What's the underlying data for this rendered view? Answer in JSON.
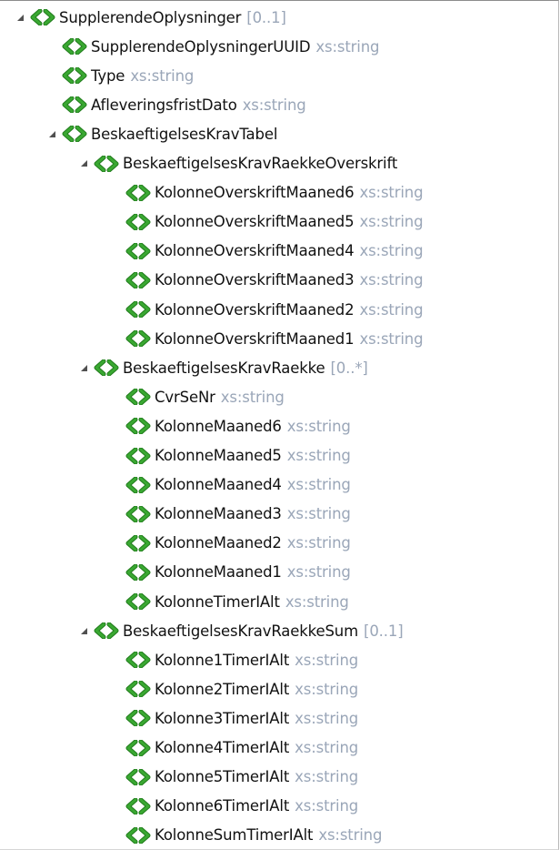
{
  "palette": {
    "icon_green": "#3aa832",
    "icon_green_dark": "#1f7a1a",
    "name_text": "#111111",
    "type_text": "#9aa6b8",
    "toggle": "#505050"
  },
  "tree": {
    "rows": [
      {
        "name": "SupplerendeOplysninger",
        "type": "[0..1]",
        "depth": 0,
        "expandable": true,
        "icon": "element-icon"
      },
      {
        "name": "SupplerendeOplysningerUUID",
        "type": "xs:string",
        "depth": 1,
        "expandable": false,
        "icon": "element-icon"
      },
      {
        "name": "Type",
        "type": "xs:string",
        "depth": 1,
        "expandable": false,
        "icon": "element-icon"
      },
      {
        "name": "AfleveringsfristDato",
        "type": "xs:string",
        "depth": 1,
        "expandable": false,
        "icon": "element-icon"
      },
      {
        "name": "BeskaeftigelsesKravTabel",
        "type": "",
        "depth": 1,
        "expandable": true,
        "icon": "element-icon"
      },
      {
        "name": "BeskaeftigelsesKravRaekkeOverskrift",
        "type": "",
        "depth": 2,
        "expandable": true,
        "icon": "element-icon"
      },
      {
        "name": "KolonneOverskriftMaaned6",
        "type": "xs:string",
        "depth": 3,
        "expandable": false,
        "icon": "element-icon"
      },
      {
        "name": "KolonneOverskriftMaaned5",
        "type": "xs:string",
        "depth": 3,
        "expandable": false,
        "icon": "element-icon"
      },
      {
        "name": "KolonneOverskriftMaaned4",
        "type": "xs:string",
        "depth": 3,
        "expandable": false,
        "icon": "element-icon"
      },
      {
        "name": "KolonneOverskriftMaaned3",
        "type": "xs:string",
        "depth": 3,
        "expandable": false,
        "icon": "element-icon"
      },
      {
        "name": "KolonneOverskriftMaaned2",
        "type": "xs:string",
        "depth": 3,
        "expandable": false,
        "icon": "element-icon"
      },
      {
        "name": "KolonneOverskriftMaaned1",
        "type": "xs:string",
        "depth": 3,
        "expandable": false,
        "icon": "element-icon"
      },
      {
        "name": "BeskaeftigelsesKravRaekke",
        "type": "[0..*]",
        "depth": 2,
        "expandable": true,
        "icon": "element-icon"
      },
      {
        "name": "CvrSeNr",
        "type": "xs:string",
        "depth": 3,
        "expandable": false,
        "icon": "element-icon"
      },
      {
        "name": "KolonneMaaned6",
        "type": "xs:string",
        "depth": 3,
        "expandable": false,
        "icon": "element-icon"
      },
      {
        "name": "KolonneMaaned5",
        "type": "xs:string",
        "depth": 3,
        "expandable": false,
        "icon": "element-icon"
      },
      {
        "name": "KolonneMaaned4",
        "type": "xs:string",
        "depth": 3,
        "expandable": false,
        "icon": "element-icon"
      },
      {
        "name": "KolonneMaaned3",
        "type": "xs:string",
        "depth": 3,
        "expandable": false,
        "icon": "element-icon"
      },
      {
        "name": "KolonneMaaned2",
        "type": "xs:string",
        "depth": 3,
        "expandable": false,
        "icon": "element-icon"
      },
      {
        "name": "KolonneMaaned1",
        "type": "xs:string",
        "depth": 3,
        "expandable": false,
        "icon": "element-icon"
      },
      {
        "name": "KolonneTimerIAlt",
        "type": "xs:string",
        "depth": 3,
        "expandable": false,
        "icon": "element-icon"
      },
      {
        "name": "BeskaeftigelsesKravRaekkeSum",
        "type": "[0..1]",
        "depth": 2,
        "expandable": true,
        "icon": "element-icon"
      },
      {
        "name": "Kolonne1TimerIAlt",
        "type": "xs:string",
        "depth": 3,
        "expandable": false,
        "icon": "element-icon"
      },
      {
        "name": "Kolonne2TimerIAlt",
        "type": "xs:string",
        "depth": 3,
        "expandable": false,
        "icon": "element-icon"
      },
      {
        "name": "Kolonne3TimerIAlt",
        "type": "xs:string",
        "depth": 3,
        "expandable": false,
        "icon": "element-icon"
      },
      {
        "name": "Kolonne4TimerIAlt",
        "type": "xs:string",
        "depth": 3,
        "expandable": false,
        "icon": "element-icon"
      },
      {
        "name": "Kolonne5TimerIAlt",
        "type": "xs:string",
        "depth": 3,
        "expandable": false,
        "icon": "element-icon"
      },
      {
        "name": "Kolonne6TimerIAlt",
        "type": "xs:string",
        "depth": 3,
        "expandable": false,
        "icon": "element-icon"
      },
      {
        "name": "KolonneSumTimerIAlt",
        "type": "xs:string",
        "depth": 3,
        "expandable": false,
        "icon": "element-icon"
      }
    ]
  }
}
